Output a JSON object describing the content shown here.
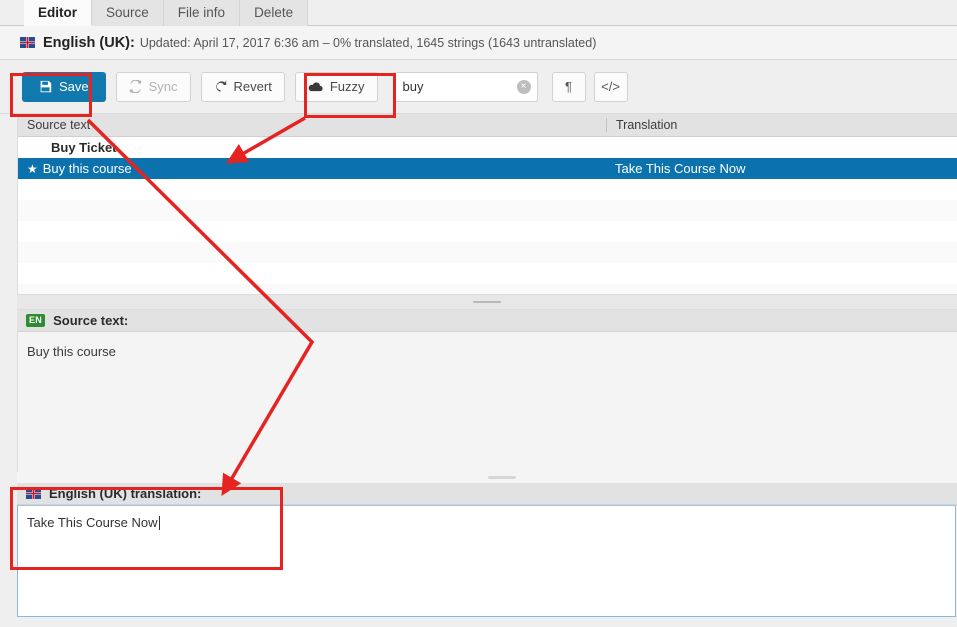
{
  "tabs": [
    {
      "label": "Editor",
      "active": true
    },
    {
      "label": "Source",
      "active": false
    },
    {
      "label": "File info",
      "active": false
    },
    {
      "label": "Delete",
      "active": false
    }
  ],
  "status": {
    "flag_icon": "uk-flag-icon",
    "language": "English (UK):",
    "detail": "Updated: April 17, 2017 6:36 am – 0% translated, 1645 strings (1643 untranslated)"
  },
  "toolbar": {
    "save_label": "Save",
    "save_icon": "floppy-disk-icon",
    "sync_label": "Sync",
    "sync_icon": "refresh-icon",
    "revert_label": "Revert",
    "revert_icon": "circular-arrow-icon",
    "fuzzy_label": "Fuzzy",
    "fuzzy_icon": "cloud-icon",
    "search_value": "buy",
    "search_placeholder": "",
    "clear_icon": "×",
    "paragraph_label": "¶",
    "code_label": "</>",
    "save_bg": "#1279ae"
  },
  "list": {
    "columns": {
      "source": "Source text",
      "translation": "Translation"
    },
    "rows": [
      {
        "source": "Buy Ticket",
        "translation": "",
        "bold": true,
        "selected": false,
        "star": false
      },
      {
        "source": "Buy this course",
        "translation": "Take This Course Now",
        "bold": false,
        "selected": true,
        "star": true
      }
    ],
    "selected_bg": "#0b72ad"
  },
  "source_pane": {
    "badge": "EN",
    "badge_color": "#2e8b32",
    "title": "Source text:",
    "text": "Buy this course"
  },
  "translation_pane": {
    "flag_icon": "uk-flag-icon",
    "title": "English (UK) translation:",
    "value": "Take This Course Now",
    "focus_border": "#8ab9dd"
  },
  "annotations": {
    "color": "#e52421",
    "boxes": [
      "save-button",
      "search-input",
      "translation-field"
    ],
    "arrows": [
      "search-to-selected-row",
      "save-to-translation-field"
    ]
  }
}
